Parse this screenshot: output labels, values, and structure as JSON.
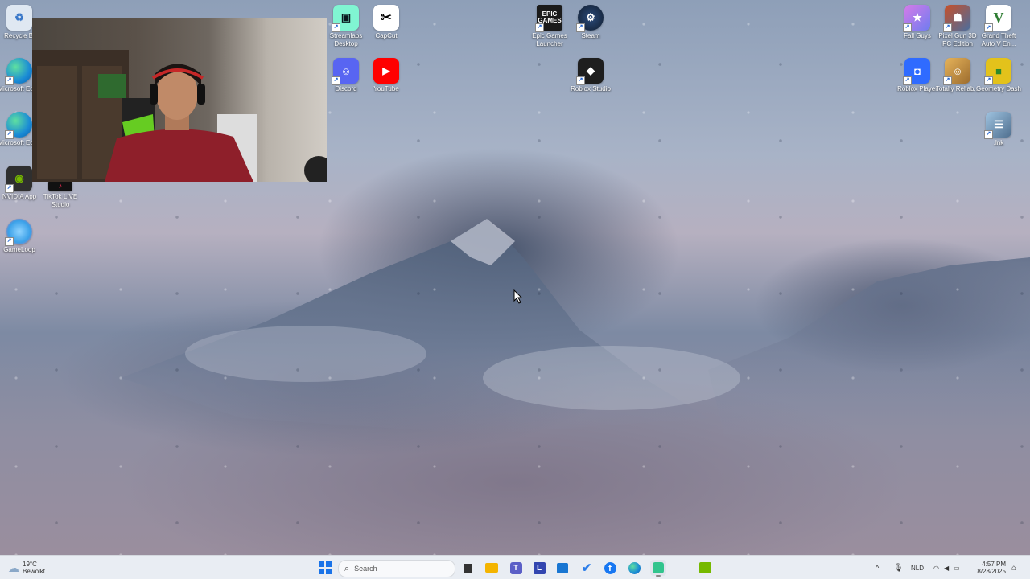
{
  "desktop": {
    "wallpaper": "rainy-mountain",
    "icons_left": [
      {
        "name": "recycle-bin",
        "label": "Recycle Bi",
        "icon": "recycle-icon",
        "color": "#dfe8f2"
      },
      {
        "name": "edge-1",
        "label": "Microsoft Edge",
        "icon": "edge-icon",
        "color": "#1a8bd6"
      },
      {
        "name": "edge-2",
        "label": "Microsoft Edge",
        "icon": "edge-icon",
        "color": "#1a8bd6"
      },
      {
        "name": "nvidia-app",
        "label": "NVIDIA App",
        "icon": "nvidia-icon",
        "color": "#3d3d3d"
      },
      {
        "name": "tiktok-live-studio",
        "label": "TikTok LIVE Studio",
        "icon": "tiktok-icon",
        "color": "#111111"
      },
      {
        "name": "gameloop",
        "label": "GameLoop",
        "icon": "gameloop-icon",
        "color": "#3aa0e8"
      }
    ],
    "icons_top": [
      {
        "name": "streamlabs",
        "label": "Streamlabs Desktop",
        "icon": "streamlabs-icon",
        "color": "#80f5d2"
      },
      {
        "name": "capcut",
        "label": "CapCut",
        "icon": "capcut-icon",
        "color": "#ffffff"
      },
      {
        "name": "discord",
        "label": "Discord",
        "icon": "discord-icon",
        "color": "#5865f2"
      },
      {
        "name": "youtube",
        "label": "YouTube",
        "icon": "youtube-icon",
        "color": "#ff0000"
      },
      {
        "name": "epic-games",
        "label": "Epic Games Launcher",
        "icon": "epic-icon",
        "color": "#1b1b1b"
      },
      {
        "name": "steam",
        "label": "Steam",
        "icon": "steam-icon",
        "color": "#1b2838"
      },
      {
        "name": "roblox-studio",
        "label": "Roblox Studio",
        "icon": "roblox-studio-icon",
        "color": "#1e1e1e"
      }
    ],
    "icons_right": [
      {
        "name": "fall-guys",
        "label": "Fall Guys",
        "icon": "fall-guys-icon",
        "color": "#8a7be8"
      },
      {
        "name": "pixel-gun",
        "label": "Pixel Gun 3D PC Edition",
        "icon": "pixel-gun-icon",
        "color": "#4a6e9e"
      },
      {
        "name": "gta-v",
        "label": "Grand Theft Auto V En...",
        "icon": "gta-icon",
        "color": "#2e7d32"
      },
      {
        "name": "roblox-player",
        "label": "Roblox Player",
        "icon": "roblox-icon",
        "color": "#2f6bff"
      },
      {
        "name": "totally-reliable",
        "label": "Totally Reliab...",
        "icon": "trds-icon",
        "color": "#c69b4a"
      },
      {
        "name": "geometry-dash",
        "label": "Geometry Dash",
        "icon": "geometry-dash-icon",
        "color": "#e3c21b"
      },
      {
        "name": "lnk",
        "label": ".lnk",
        "icon": "shortcut-icon",
        "color": "#7aa0c0"
      }
    ]
  },
  "taskbar": {
    "weather": {
      "temp": "19°C",
      "condition": "Bewolkt"
    },
    "search_placeholder": "Search",
    "apps": [
      {
        "name": "start-button",
        "icon": "windows-icon",
        "color": "#1a73e8"
      },
      {
        "name": "task-view",
        "icon": "task-view-icon",
        "color": "#333333"
      },
      {
        "name": "file-explorer",
        "icon": "folder-icon",
        "color": "#f4b400"
      },
      {
        "name": "teams",
        "icon": "teams-icon",
        "color": "#5b5fc7"
      },
      {
        "name": "app-l",
        "icon": "l-icon",
        "color": "#3346b0",
        "text": "L"
      },
      {
        "name": "store",
        "icon": "store-icon",
        "color": "#1976d2"
      },
      {
        "name": "todo",
        "icon": "check-icon",
        "color": "#2b7de9"
      },
      {
        "name": "facebook",
        "icon": "facebook-icon",
        "color": "#1877f2"
      },
      {
        "name": "edge",
        "icon": "edge-icon",
        "color": "#1a8bd6"
      },
      {
        "name": "streamlabs",
        "icon": "streamlabs-icon",
        "color": "#31c48d"
      },
      {
        "name": "nvidia",
        "icon": "nvidia-icon",
        "color": "#76b900"
      }
    ],
    "tray": {
      "lang": "NLD",
      "time": "4:57 PM",
      "date": "8/28/2025"
    }
  }
}
